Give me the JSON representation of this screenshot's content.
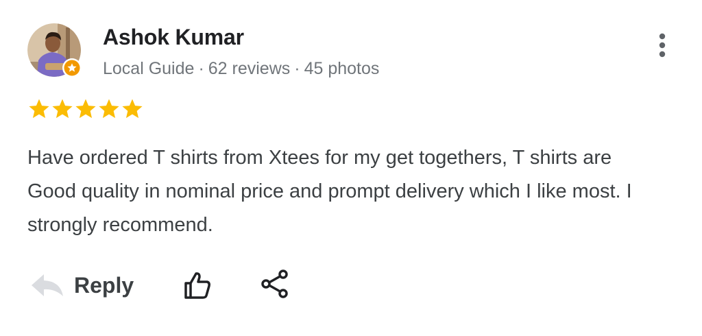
{
  "review": {
    "reviewer": {
      "name": "Ashok Kumar",
      "badge": "Local Guide",
      "reviews": "62 reviews",
      "photos": "45 photos",
      "separator": "·",
      "avatar_icon": "user-photo",
      "badge_icon": "local-guide-star-icon"
    },
    "rating": 5,
    "text": "Have ordered T shirts from Xtees for my get togethers, T shirts are Good quality in nominal price and prompt delivery which I like most. I strongly recommend.",
    "more_icon": "more-vert-icon"
  },
  "actions": {
    "reply_label": "Reply",
    "reply_icon": "reply-arrow-icon",
    "like_icon": "thumbs-up-icon",
    "share_icon": "share-icon"
  },
  "colors": {
    "star": "#fbbc04",
    "name": "#202124",
    "meta": "#70757a",
    "body": "#3c4043",
    "reply_icon": "#dadce0",
    "badge": "#f29900"
  }
}
